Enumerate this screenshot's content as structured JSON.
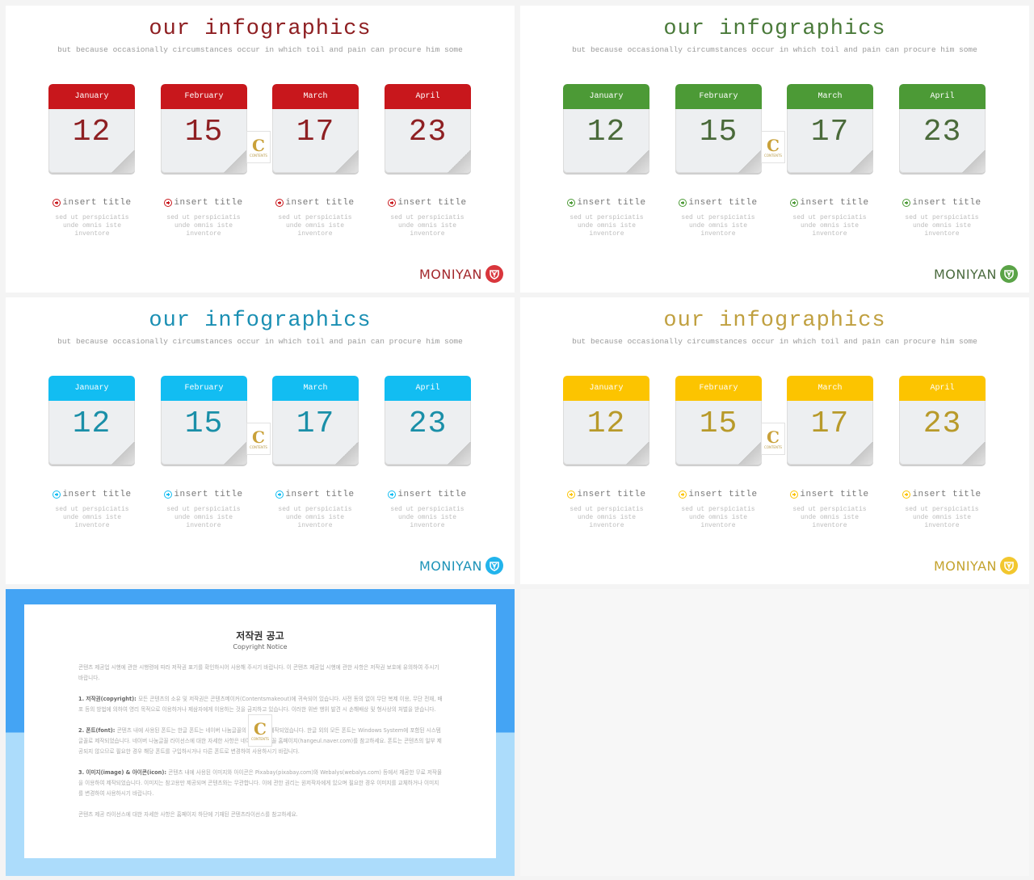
{
  "slides": [
    {
      "title": "our infographics",
      "subtitle": "but because occasionally circumstances occur in which toil and pain can procure him some",
      "accent": "#c8171c",
      "title_color": "#8e1f22",
      "num_color": "#8e1f22",
      "calendars": [
        {
          "month": "January",
          "day": "12"
        },
        {
          "month": "February",
          "day": "15"
        },
        {
          "month": "March",
          "day": "17"
        },
        {
          "month": "April",
          "day": "23"
        }
      ],
      "items": [
        {
          "icon": "plus-circle-icon",
          "title": "insert title",
          "desc": "sed ut perspiciatis unde omnis iste inventore"
        },
        {
          "icon": "plus-circle-icon",
          "title": "insert title",
          "desc": "sed ut perspiciatis unde omnis iste inventore"
        },
        {
          "icon": "plus-circle-icon",
          "title": "insert title",
          "desc": "sed ut perspiciatis unde omnis iste inventore"
        },
        {
          "icon": "plus-circle-icon",
          "title": "insert title",
          "desc": "sed ut perspiciatis unde omnis iste inventore"
        }
      ],
      "brand": "MONIYAN",
      "brand_color": "#a3282c",
      "brand_icon_color": "#d9363c",
      "watermark": {
        "letter": "C",
        "text": "CONTENTS"
      }
    },
    {
      "title": "our infographics",
      "subtitle": "but because occasionally circumstances occur in which toil and pain can procure him some",
      "accent": "#4c9a36",
      "title_color": "#4a7a3a",
      "num_color": "#4a6a3a",
      "calendars": [
        {
          "month": "January",
          "day": "12"
        },
        {
          "month": "February",
          "day": "15"
        },
        {
          "month": "March",
          "day": "17"
        },
        {
          "month": "April",
          "day": "23"
        }
      ],
      "items": [
        {
          "icon": "plus-circle-icon",
          "title": "insert title",
          "desc": "sed ut perspiciatis unde omnis iste inventore"
        },
        {
          "icon": "plus-circle-icon",
          "title": "insert title",
          "desc": "sed ut perspiciatis unde omnis iste inventore"
        },
        {
          "icon": "plus-circle-icon",
          "title": "insert title",
          "desc": "sed ut perspiciatis unde omnis iste inventore"
        },
        {
          "icon": "plus-circle-icon",
          "title": "insert title",
          "desc": "sed ut perspiciatis unde omnis iste inventore"
        }
      ],
      "brand": "MONIYAN",
      "brand_color": "#4b6b3f",
      "brand_icon_color": "#5aa347",
      "watermark": {
        "letter": "C",
        "text": "CONTENTS"
      }
    },
    {
      "title": "our infographics",
      "subtitle": "but because occasionally circumstances occur in which toil and pain can procure him some",
      "accent": "#12bdf2",
      "title_color": "#1a8fb3",
      "num_color": "#1a8fa8",
      "calendars": [
        {
          "month": "January",
          "day": "12"
        },
        {
          "month": "February",
          "day": "15"
        },
        {
          "month": "March",
          "day": "17"
        },
        {
          "month": "April",
          "day": "23"
        }
      ],
      "items": [
        {
          "icon": "plus-circle-icon",
          "title": "insert title",
          "desc": "sed ut perspiciatis unde omnis iste inventore"
        },
        {
          "icon": "plus-circle-icon",
          "title": "insert title",
          "desc": "sed ut perspiciatis unde omnis iste inventore"
        },
        {
          "icon": "plus-circle-icon",
          "title": "insert title",
          "desc": "sed ut perspiciatis unde omnis iste inventore"
        },
        {
          "icon": "plus-circle-icon",
          "title": "insert title",
          "desc": "sed ut perspiciatis unde omnis iste inventore"
        }
      ],
      "brand": "MONIYAN",
      "brand_color": "#1d93b8",
      "brand_icon_color": "#22b4ec",
      "watermark": {
        "letter": "C",
        "text": "CONTENTS"
      }
    },
    {
      "title": "our infographics",
      "subtitle": "but because occasionally circumstances occur in which toil and pain can procure him some",
      "accent": "#fcc400",
      "title_color": "#c0a040",
      "num_color": "#b89a2a",
      "calendars": [
        {
          "month": "January",
          "day": "12"
        },
        {
          "month": "February",
          "day": "15"
        },
        {
          "month": "March",
          "day": "17"
        },
        {
          "month": "April",
          "day": "23"
        }
      ],
      "items": [
        {
          "icon": "plus-circle-icon",
          "title": "insert title",
          "desc": "sed ut perspiciatis unde omnis iste inventore"
        },
        {
          "icon": "plus-circle-icon",
          "title": "insert title",
          "desc": "sed ut perspiciatis unde omnis iste inventore"
        },
        {
          "icon": "plus-circle-icon",
          "title": "insert title",
          "desc": "sed ut perspiciatis unde omnis iste inventore"
        },
        {
          "icon": "plus-circle-icon",
          "title": "insert title",
          "desc": "sed ut perspiciatis unde omnis iste inventore"
        }
      ],
      "brand": "MONIYAN",
      "brand_color": "#c4a32e",
      "brand_icon_color": "#f2c72e",
      "watermark": {
        "letter": "C",
        "text": "CONTENTS"
      }
    }
  ],
  "notice": {
    "title": "저작권 공고",
    "subtitle": "Copyright Notice",
    "colors": {
      "frame_top": "#44a4f4",
      "frame_bottom": "#acdcfb"
    },
    "paragraphs": [
      {
        "lead": "",
        "text": "콘텐츠 제공업 시행에 관한 시행령에 따라 저작권 표기를 확인하시어 사용해 주시기 바랍니다. 이 콘텐츠 제공업 시행에 관한 사항은 저작권 보호에 유의하여 주시기 바랍니다."
      },
      {
        "lead": "1. 저작권(copyright): ",
        "text": "모든 콘텐츠의 소유 및 저작권은 콘텐츠메이커(Contentsmakeout)에 귀속되어 있습니다. 사전 동의 없이 무단 복제 이용, 무단 전재, 배포 등의 방법에 의하여 영리 목적으로 이용하거나 제삼자에게 이용하는 것을 금지하고 있습니다. 이러한 위반 행위 발견 시 손해배상 및 형사상의 처벌을 받습니다."
      },
      {
        "lead": "2. 폰트(font): ",
        "text": "콘텐츠 내에 사용된 폰트는 한글 폰트는 네이버 나눔글꼴의 저작물로 제작되었습니다. 한글 외의 모든 폰트는 Windows System에 포함된 시스템 글꼴로 제작되었습니다. 네이버 나눔글꼴 라이선스에 대한 자세한 사항은 네이버 나눔글꼴 홈페이지(hangeul.naver.com)를 참고하세요. 폰트는 콘텐츠의 일부 제공되지 않으므로 필요한 경우 해당 폰트를 구입하시거나 다른 폰트로 변경하여 사용하시기 바랍니다."
      },
      {
        "lead": "3. 이미지(image) & 아이콘(icon): ",
        "text": "콘텐츠 내에 사용된 이미지와 아이콘은 Pixabay(pixabay.com)와 Webalys(webalys.com) 등에서 제공한 무료 저작물을 이용하여 제작되었습니다. 이미지는 참고용만 제공되며 콘텐츠와는 무관합니다. 이에 관한 권리는 원저작자에게 있으며 필요한 경우 이미지를 교체하거나 이미지를 변경하여 사용하시기 바랍니다."
      },
      {
        "lead": "",
        "text": "콘텐츠 제공 라이선스에 대한 자세한 사항은 홈페이지 하단에 기재된 콘텐츠라이선스를 참고하세요."
      }
    ],
    "watermark": {
      "letter": "C",
      "text": "CONTENTS"
    }
  }
}
